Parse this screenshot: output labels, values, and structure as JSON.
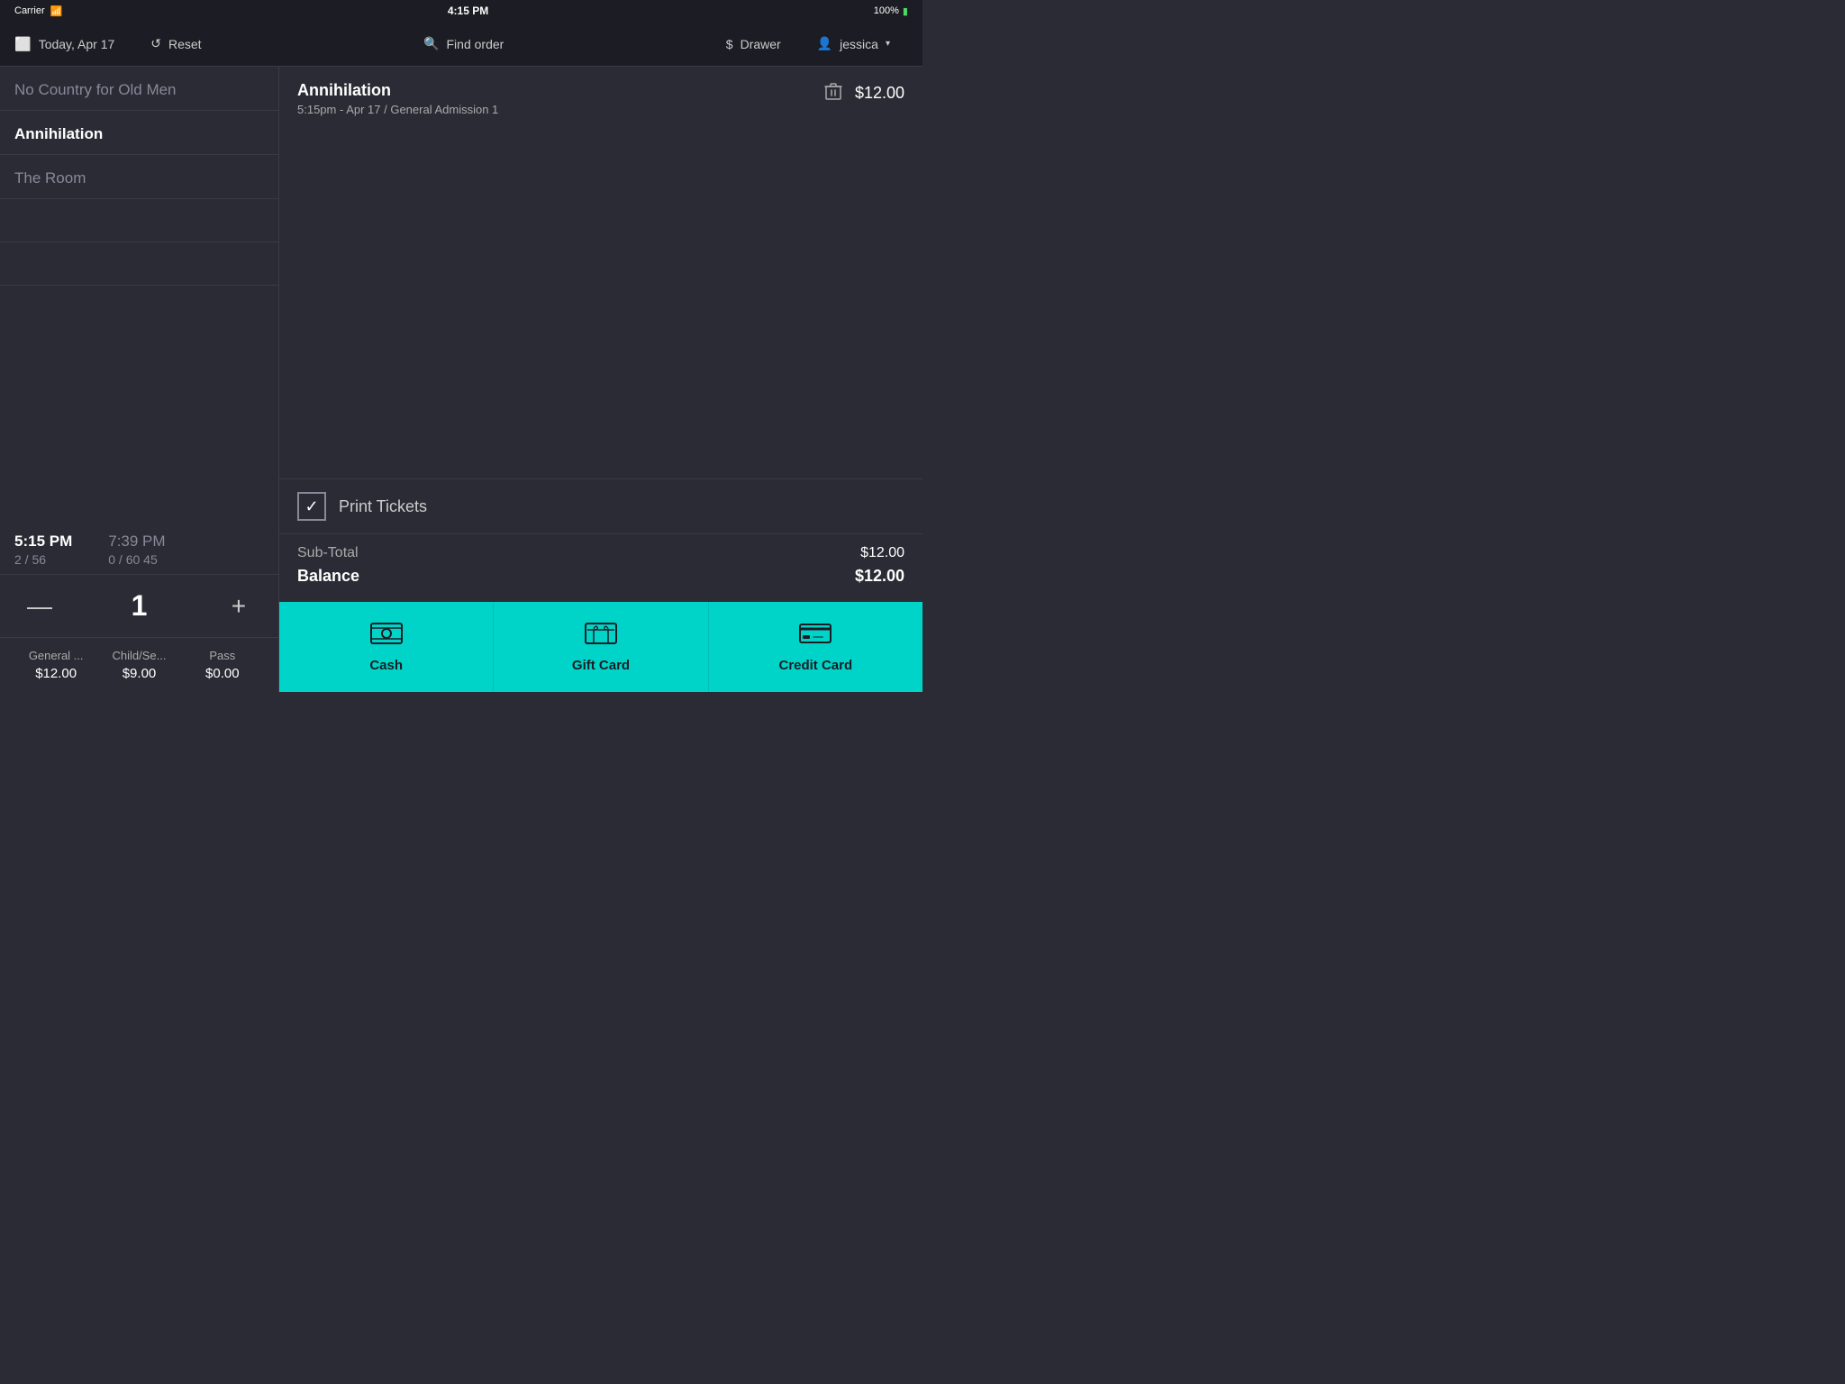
{
  "statusBar": {
    "carrier": "Carrier",
    "wifi": "wifi",
    "time": "4:15 PM",
    "battery": "100%"
  },
  "navBar": {
    "date": "Today, Apr 17",
    "reset": "Reset",
    "findOrder": "Find order",
    "drawer": "Drawer",
    "user": "jessica"
  },
  "leftPanel": {
    "movies": [
      {
        "title": "No Country for Old Men",
        "active": false
      },
      {
        "title": "Annihilation",
        "active": true
      },
      {
        "title": "The Room",
        "active": false
      }
    ],
    "showtimes": [
      {
        "time": "5:15 PM",
        "seats": "2 / 56"
      },
      {
        "time": "7:39 PM",
        "seats": "0 / 60   45"
      }
    ],
    "quantity": "1",
    "ticketTypes": [
      {
        "name": "General ...",
        "price": "$12.00"
      },
      {
        "name": "Child/Se...",
        "price": "$9.00"
      },
      {
        "name": "Pass",
        "price": "$0.00"
      }
    ]
  },
  "rightPanel": {
    "orderItem": {
      "title": "Annihilation",
      "detail": "5:15pm - Apr 17 / General Admission 1",
      "price": "$12.00"
    },
    "printTickets": {
      "label": "Print Tickets",
      "checked": true
    },
    "subTotal": {
      "label": "Sub-Total",
      "value": "$12.00"
    },
    "balance": {
      "label": "Balance",
      "value": "$12.00"
    }
  },
  "paymentBar": {
    "options": [
      {
        "label": "Cash",
        "icon": "cash"
      },
      {
        "label": "Gift Card",
        "icon": "gift"
      },
      {
        "label": "Credit Card",
        "icon": "credit"
      }
    ]
  },
  "icons": {
    "minus": "—",
    "plus": "+",
    "trash": "🗑",
    "checkmark": "✓",
    "chevronDown": "∨"
  }
}
